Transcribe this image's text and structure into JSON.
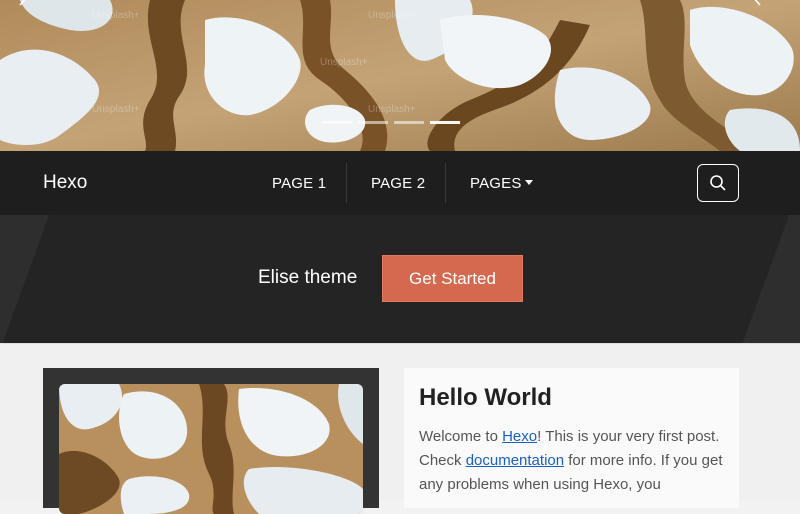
{
  "hero": {
    "watermarks": [
      "Unsplash+",
      "Unsplash+",
      "Unsplash+",
      "Unsplash+",
      "Unsplash+"
    ],
    "slides": 4,
    "active_slide": 3
  },
  "navbar": {
    "brand": "Hexo",
    "links": [
      {
        "label": "PAGE 1"
      },
      {
        "label": "PAGE 2"
      },
      {
        "label": "PAGES"
      }
    ]
  },
  "banner": {
    "text": "Elise theme",
    "button_label": "Get Started"
  },
  "post": {
    "title": "Hello World",
    "excerpt_1": "Welcome to ",
    "link_hexo": "Hexo",
    "excerpt_2": "! This is your very first post. Check ",
    "link_docs": "documentation",
    "excerpt_3": " for more info. If you get any problems when using Hexo, you"
  },
  "colors": {
    "accent": "#d4694f",
    "navbar_bg": "#1e1e1e",
    "banner_bg": "#242424",
    "link": "#1a5fc4"
  },
  "icons": [
    "chevron-left-icon",
    "chevron-right-icon",
    "search-icon",
    "caret-down-icon"
  ]
}
